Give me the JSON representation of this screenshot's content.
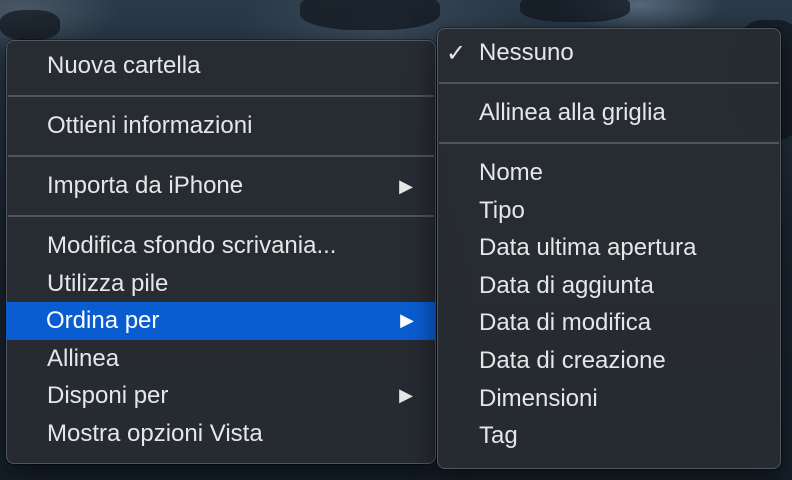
{
  "context_menu": {
    "groups": [
      [
        {
          "label": "Nuova cartella"
        }
      ],
      [
        {
          "label": "Ottieni informazioni"
        }
      ],
      [
        {
          "label": "Importa da iPhone",
          "submenu_arrow": "▶"
        }
      ],
      [
        {
          "label": "Modifica sfondo scrivania..."
        },
        {
          "label": "Utilizza pile"
        },
        {
          "label": "Ordina per",
          "submenu_arrow": "▶",
          "highlighted": true
        },
        {
          "label": "Allinea"
        },
        {
          "label": "Disponi per",
          "submenu_arrow": "▶"
        },
        {
          "label": "Mostra opzioni Vista"
        }
      ]
    ]
  },
  "sort_submenu": {
    "checkmark": "✓",
    "none_label": "Nessuno",
    "snap_to_grid_label": "Allinea alla griglia",
    "sort_options": [
      "Nome",
      "Tipo",
      "Data ultima apertura",
      "Data di aggiunta",
      "Data di modifica",
      "Data di creazione",
      "Dimensioni",
      "Tag"
    ]
  },
  "colors": {
    "highlight": "#0a5dd1",
    "menu_background": "#282c32",
    "text": "#e6e6e7"
  }
}
